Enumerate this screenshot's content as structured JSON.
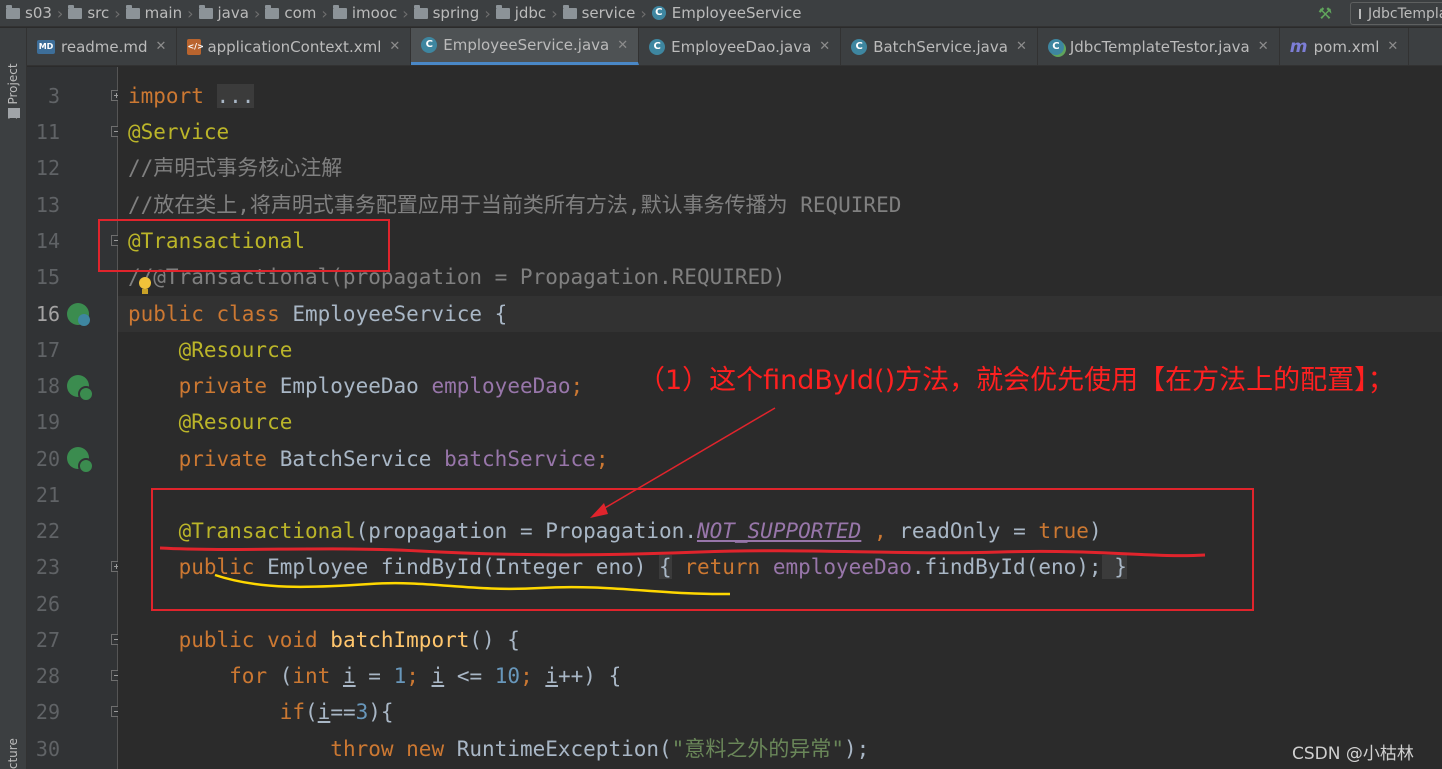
{
  "breadcrumb": {
    "items": [
      "s03",
      "src",
      "main",
      "java",
      "com",
      "imooc",
      "spring",
      "jdbc",
      "service",
      "EmployeeService"
    ]
  },
  "toolbar": {
    "run_config": "JdbcTemplateTestor"
  },
  "tool_stripe": {
    "project": "1: Project",
    "structure": "Structure"
  },
  "tabs": [
    {
      "label": "readme.md",
      "icon": "markdown-file-icon"
    },
    {
      "label": "applicationContext.xml",
      "icon": "xml-file-icon"
    },
    {
      "label": "EmployeeService.java",
      "icon": "java-class-icon",
      "active": true
    },
    {
      "label": "EmployeeDao.java",
      "icon": "java-class-icon"
    },
    {
      "label": "BatchService.java",
      "icon": "java-class-icon"
    },
    {
      "label": "JdbcTemplateTestor.java",
      "icon": "java-test-class-icon"
    },
    {
      "label": "pom.xml",
      "icon": "maven-icon"
    }
  ],
  "editor": {
    "line_numbers": [
      "3",
      "11",
      "12",
      "13",
      "14",
      "15",
      "16",
      "17",
      "18",
      "19",
      "20",
      "21",
      "22",
      "23",
      "26",
      "27",
      "28",
      "29",
      "30"
    ],
    "current_line": "16",
    "code": {
      "l3_kw": "import",
      "l3_fold": "...",
      "l11": "@Service",
      "l12": "//声明式事务核心注解",
      "l13": "//放在类上,将声明式事务配置应用于当前类所有方法,默认事务传播为 REQUIRED",
      "l14": "@Transactional",
      "l15": "//@Transactional(propagation = Propagation.REQUIRED)",
      "l16_kw": "public class",
      "l16_rest": " EmployeeService {",
      "l17": "@Resource",
      "l18_kw": "private",
      "l18_type": " EmployeeDao ",
      "l18_field": "employeeDao",
      "l18_end": ";",
      "l19": "@Resource",
      "l20_kw": "private",
      "l20_type": " BatchService ",
      "l20_field": "batchService",
      "l20_end": ";",
      "l22_ann": "@Transactional",
      "l22_mid": "(propagation = Propagation.",
      "l22_const": "NOT_SUPPORTED",
      "l22_comma": " , ",
      "l22_ro": "readOnly = ",
      "l22_true": "true",
      "l22_close": ")",
      "l23_kw": "public",
      "l23_sig": " Employee findById(Integer eno) ",
      "l23_open": "{",
      "l23_ret": " return ",
      "l23_field": "employeeDao",
      "l23_call": ".findById(eno);",
      "l23_close": " }",
      "l27_kw": "public void",
      "l27_name": " batchImport",
      "l27_rest": "() {",
      "l28_for": "for",
      "l28_a": " (",
      "l28_int": "int",
      "l28_b": " ",
      "l28_i1": "i",
      "l28_c": " = ",
      "l28_one": "1",
      "l28_d": "; ",
      "l28_i2": "i",
      "l28_e": " <= ",
      "l28_ten": "10",
      "l28_f": "; ",
      "l28_i3": "i",
      "l28_g": "++) {",
      "l29_if": "if",
      "l29_a": "(",
      "l29_i": "i",
      "l29_b": "==",
      "l29_three": "3",
      "l29_c": "){",
      "l30_throw": "throw new",
      "l30_a": " RuntimeException(",
      "l30_str": "\"意料之外的异常\"",
      "l30_b": ");"
    }
  },
  "annotation": {
    "callout": "（1）这个findById()方法，就会优先使用【在方法上的配置】；",
    "watermark": "CSDN @小枯林",
    "colors": {
      "box": "#e0242c",
      "underline": "#e0242c",
      "highlight": "#ffd800",
      "text": "#ff2020"
    }
  }
}
